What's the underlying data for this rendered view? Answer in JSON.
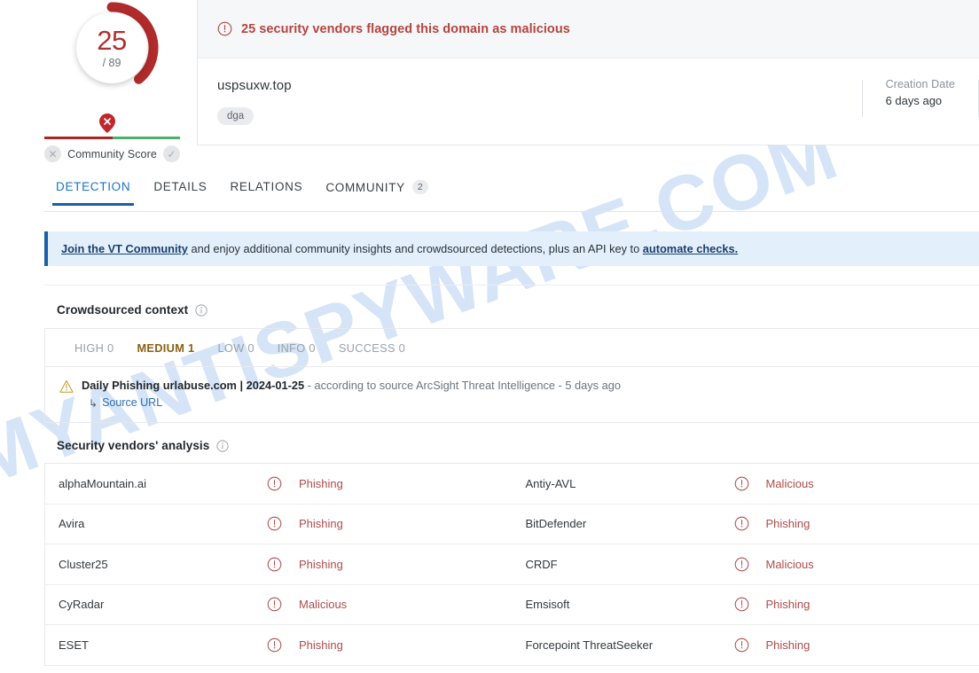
{
  "watermark": {
    "text": "MYANTISPYWARE.COM"
  },
  "gauge": {
    "score": "25",
    "total": "/ 89",
    "detections": 25,
    "total_engines": 89,
    "arc_color": "#b02b2b"
  },
  "community_score": {
    "label": "Community Score",
    "negative_icon": "x-circle-icon",
    "positive_icon": "check-circle-icon",
    "pin_icon": "map-pin-x-icon"
  },
  "header": {
    "alert": "25 security vendors flagged this domain as malicious",
    "alert_icon": "exclamation-circle-icon",
    "domain": "uspsuxw.top",
    "tags": [
      "dga"
    ],
    "creation_label": "Creation Date",
    "creation_value": "6 days ago"
  },
  "tabs": [
    {
      "label": "DETECTION",
      "active": true,
      "badge": ""
    },
    {
      "label": "DETAILS",
      "active": false,
      "badge": ""
    },
    {
      "label": "RELATIONS",
      "active": false,
      "badge": ""
    },
    {
      "label": "COMMUNITY",
      "active": false,
      "badge": "2"
    }
  ],
  "vt_banner": {
    "link1": "Join the VT Community",
    "middle": " and enjoy additional community insights and crowdsourced detections, plus an API key to ",
    "link2": "automate checks."
  },
  "crowdsourced": {
    "title": "Crowdsourced context",
    "severities": [
      {
        "label": "HIGH 0",
        "active": false
      },
      {
        "label": "MEDIUM 1",
        "active": true
      },
      {
        "label": "LOW 0",
        "active": false
      },
      {
        "label": "INFO 0",
        "active": false
      },
      {
        "label": "SUCCESS 0",
        "active": false
      }
    ],
    "entry": {
      "title": "Daily Phishing urlabuse.com | 2024-01-25",
      "detail": " - according to source ArcSight Threat Intelligence - 5 days ago",
      "source_link": "Source URL",
      "icon": "warning-triangle-icon"
    }
  },
  "vendors": {
    "title": "Security vendors' analysis",
    "rows": [
      {
        "left_name": "alphaMountain.ai",
        "left_verdict": "Phishing",
        "right_name": "Antiy-AVL",
        "right_verdict": "Malicious"
      },
      {
        "left_name": "Avira",
        "left_verdict": "Phishing",
        "right_name": "BitDefender",
        "right_verdict": "Phishing"
      },
      {
        "left_name": "Cluster25",
        "left_verdict": "Phishing",
        "right_name": "CRDF",
        "right_verdict": "Malicious"
      },
      {
        "left_name": "CyRadar",
        "left_verdict": "Malicious",
        "right_name": "Emsisoft",
        "right_verdict": "Phishing"
      },
      {
        "left_name": "ESET",
        "left_verdict": "Phishing",
        "right_name": "Forcepoint ThreatSeeker",
        "right_verdict": "Phishing"
      }
    ]
  }
}
